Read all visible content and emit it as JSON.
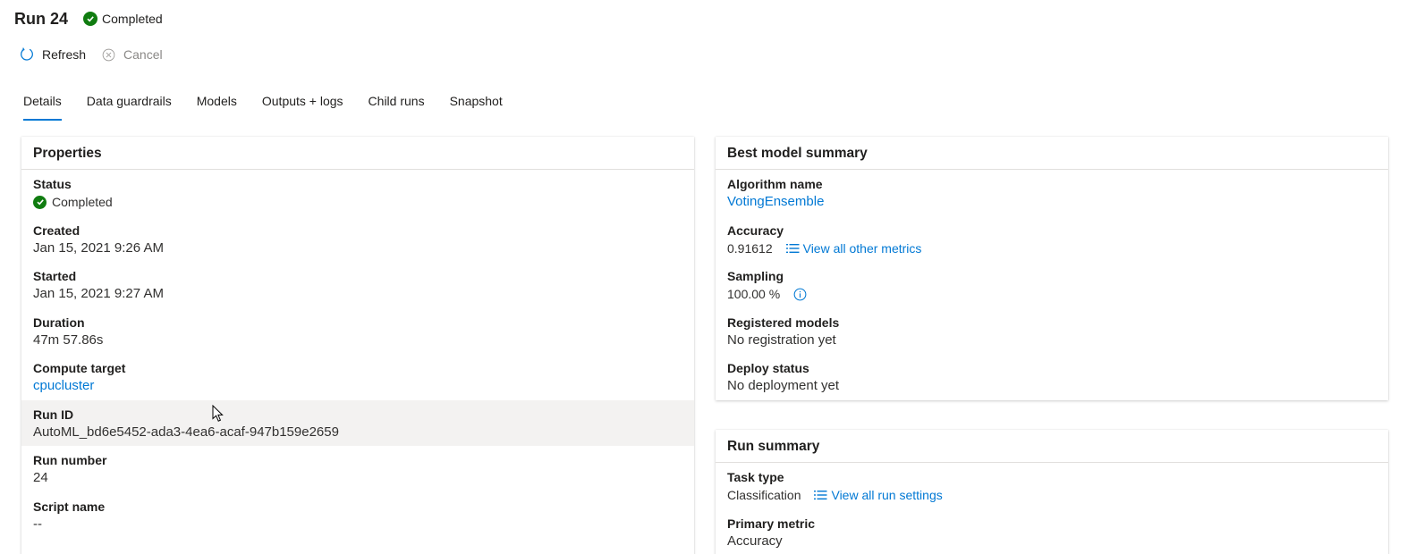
{
  "header": {
    "title": "Run 24",
    "status": "Completed"
  },
  "toolbar": {
    "refresh_label": "Refresh",
    "cancel_label": "Cancel"
  },
  "tabs": [
    {
      "label": "Details",
      "active": true
    },
    {
      "label": "Data guardrails"
    },
    {
      "label": "Models"
    },
    {
      "label": "Outputs + logs"
    },
    {
      "label": "Child runs"
    },
    {
      "label": "Snapshot"
    }
  ],
  "properties": {
    "title": "Properties",
    "status_label": "Status",
    "status_value": "Completed",
    "created_label": "Created",
    "created_value": "Jan 15, 2021 9:26 AM",
    "started_label": "Started",
    "started_value": "Jan 15, 2021 9:27 AM",
    "duration_label": "Duration",
    "duration_value": "47m 57.86s",
    "compute_label": "Compute target",
    "compute_value": "cpucluster",
    "runid_label": "Run ID",
    "runid_value": "AutoML_bd6e5452-ada3-4ea6-acaf-947b159e2659",
    "runnumber_label": "Run number",
    "runnumber_value": "24",
    "script_label": "Script name",
    "script_value": "--"
  },
  "best_model": {
    "title": "Best model summary",
    "algorithm_label": "Algorithm name",
    "algorithm_value": "VotingEnsemble",
    "accuracy_label": "Accuracy",
    "accuracy_value": "0.91612",
    "metrics_link": "View all other metrics",
    "sampling_label": "Sampling",
    "sampling_value": "100.00 %",
    "registered_label": "Registered models",
    "registered_value": "No registration yet",
    "deploy_label": "Deploy status",
    "deploy_value": "No deployment yet"
  },
  "run_summary": {
    "title": "Run summary",
    "task_label": "Task type",
    "task_value": "Classification",
    "settings_link": "View all run settings",
    "metric_label": "Primary metric",
    "metric_value": "Accuracy"
  },
  "colors": {
    "accent": "#0078d4",
    "success": "#107c10",
    "disabled": "#8a8886",
    "hover_row": "#f3f2f1"
  }
}
